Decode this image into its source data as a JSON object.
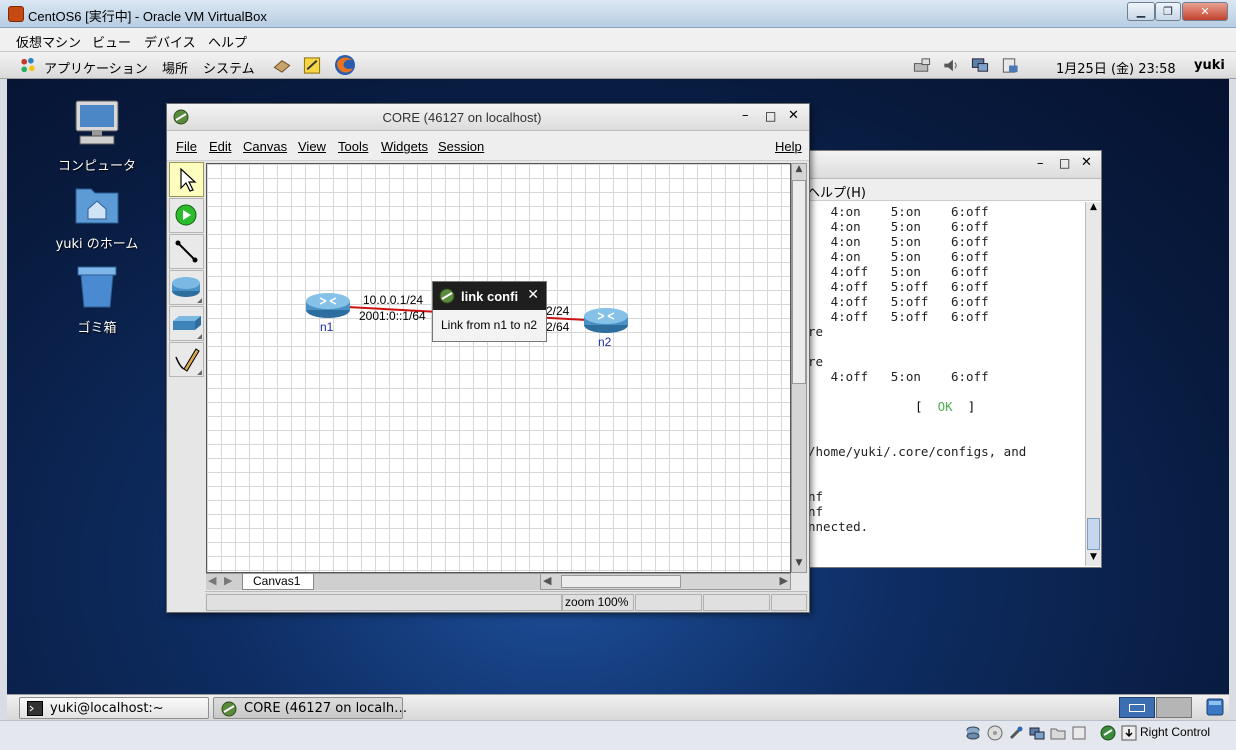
{
  "host_window": {
    "title": "CentOS6 [実行中] - Oracle VM VirtualBox",
    "menu": [
      "仮想マシン",
      "ビュー",
      "デバイス",
      "ヘルプ"
    ],
    "status_right": "Right Control"
  },
  "gnome_panel": {
    "menus": [
      "アプリケーション",
      "場所",
      "システム"
    ],
    "clock": "1月25日 (金) 23:58",
    "user": "yuki"
  },
  "desktop_icons": [
    {
      "label": "コンピュータ",
      "icon": "computer-icon"
    },
    {
      "label": "yuki のホーム",
      "icon": "home-folder-icon"
    },
    {
      "label": "ゴミ箱",
      "icon": "trash-icon"
    }
  ],
  "terminal": {
    "menu_fragment": "ヘルプ(H)",
    "lines": [
      "   4:on    5:on    6:off",
      "   4:on    5:on    6:off",
      "   4:on    5:on    6:off",
      "   4:on    5:on    6:off",
      "   4:off   5:on    6:off",
      "   4:off   5:off   6:off",
      "   4:off   5:off   6:off",
      "   4:off   5:off   6:off",
      "re",
      "",
      "re",
      "   4:off   5:on    6:off",
      "",
      "",
      "",
      "",
      "/home/yuki/.core/configs, and",
      "",
      "",
      "nf",
      "nf",
      "nnected."
    ],
    "ok_open": "[",
    "ok_text": "OK",
    "ok_close": "]"
  },
  "core_window": {
    "title": "CORE (46127 on localhost)",
    "menu": [
      "File",
      "Edit",
      "Canvas",
      "View",
      "Tools",
      "Widgets",
      "Session"
    ],
    "help": "Help",
    "nodes": [
      {
        "name": "n1"
      },
      {
        "name": "n2"
      }
    ],
    "link_labels_left": [
      "10.0.0.1/24",
      "2001:0::1/64"
    ],
    "link_labels_right": [
      "2/24",
      "2/64"
    ],
    "popup": {
      "title": "link confi",
      "body": "Link from n1 to n2"
    },
    "canvas_tab": "Canvas1",
    "zoom": "zoom 100%"
  },
  "taskbar": [
    {
      "label": "yuki@localhost:~",
      "icon": "terminal-icon"
    },
    {
      "label": "CORE (46127 on localh…",
      "icon": "core-icon"
    }
  ]
}
